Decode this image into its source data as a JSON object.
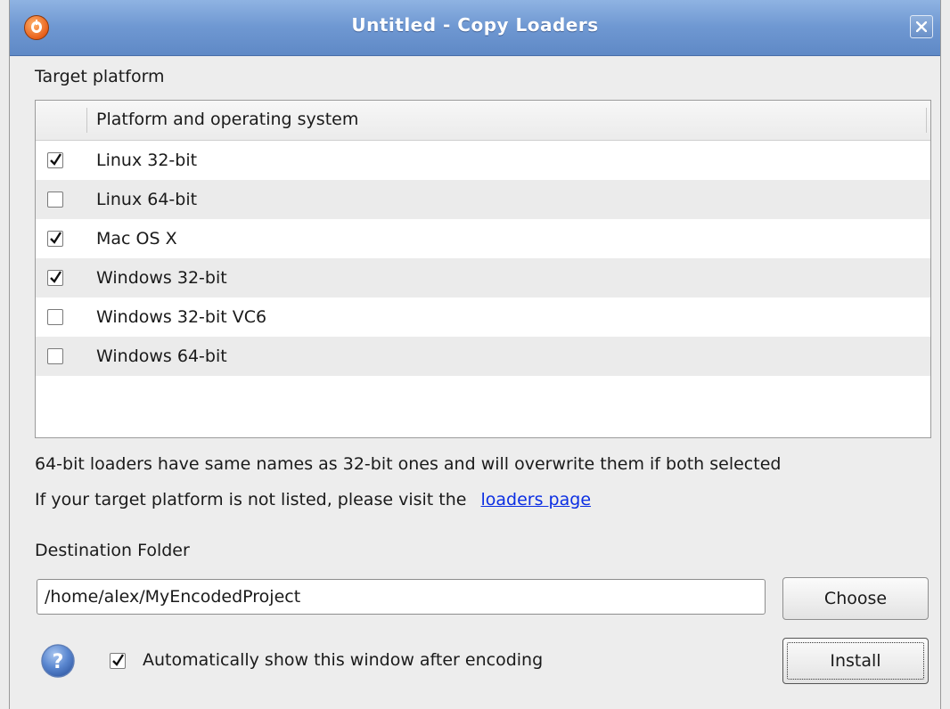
{
  "window": {
    "title": "Untitled - Copy Loaders"
  },
  "target_platform": {
    "label": "Target platform",
    "column_header": "Platform and operating system",
    "rows": [
      {
        "label": "Linux 32-bit",
        "checked": true
      },
      {
        "label": "Linux 64-bit",
        "checked": false
      },
      {
        "label": "Mac OS X",
        "checked": true
      },
      {
        "label": "Windows 32-bit",
        "checked": true
      },
      {
        "label": "Windows 32-bit VC6",
        "checked": false
      },
      {
        "label": "Windows 64-bit",
        "checked": false
      }
    ]
  },
  "notes": {
    "overwrite_warning": "64-bit loaders have same names as 32-bit ones and will overwrite them if both selected",
    "not_listed_prefix": "If your target platform is not listed, please visit the",
    "loaders_link": "loaders page"
  },
  "destination": {
    "label": "Destination Folder",
    "value": "/home/alex/MyEncodedProject",
    "choose_label": "Choose"
  },
  "footer": {
    "auto_show_label": "Automatically show this window after encoding",
    "auto_show_checked": true,
    "install_label": "Install"
  },
  "colors": {
    "titlebar": "#6f98d2",
    "link": "#0b2ee3",
    "row_alt": "#ebebeb"
  },
  "icons": {
    "app": "app-logo-icon",
    "close": "close-icon",
    "help": "help-icon",
    "check": "checkmark-icon"
  }
}
